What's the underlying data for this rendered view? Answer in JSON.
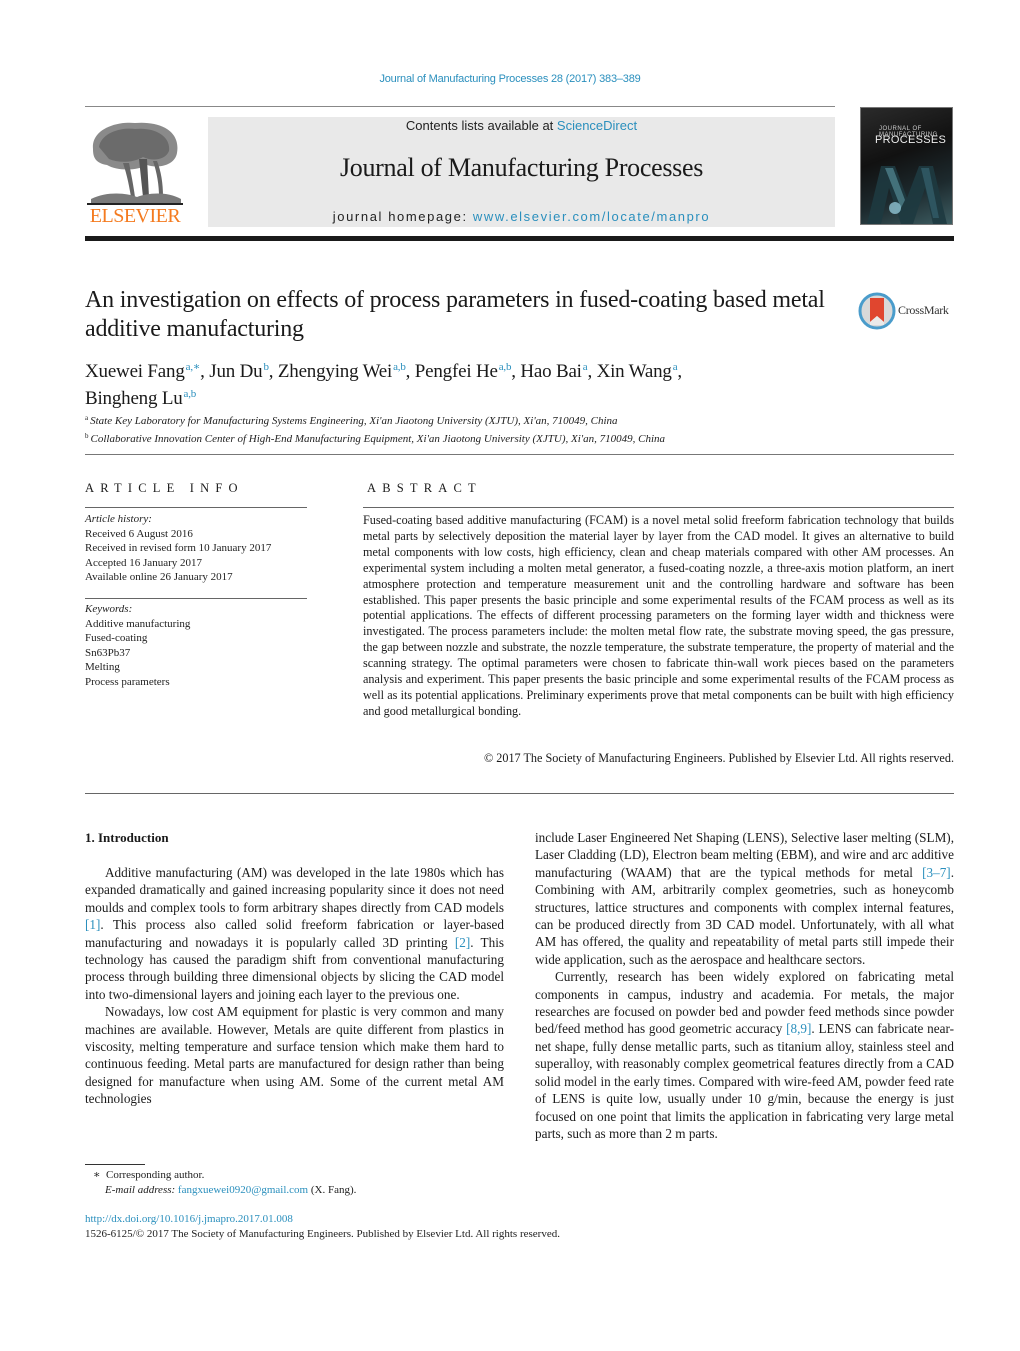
{
  "header": {
    "citation": "Journal of Manufacturing Processes 28 (2017) 383–389",
    "contents_prefix": "Contents lists available at ",
    "contents_link": "ScienceDirect",
    "journal_name": "Journal of Manufacturing Processes",
    "homepage_prefix": "journal homepage: ",
    "homepage_link": "www.elsevier.com/locate/manpro",
    "publisher_logo_text": "ELSEVIER",
    "cover_small_title": "JOURNAL OF MANUFACTURING",
    "cover_big_title": "PROCESSES",
    "colors": {
      "link": "#2a8fbd",
      "elsevier_orange": "#f47b20",
      "masthead_bg": "#e9e9e9"
    }
  },
  "article": {
    "title": "An investigation on effects of process parameters in fused-coating based metal additive manufacturing",
    "crossmark_label": "CrossMark",
    "authors": [
      {
        "name": "Xuewei Fang",
        "sup": "a,∗",
        "sep": ", "
      },
      {
        "name": "Jun Du",
        "sup": "b",
        "sep": ", "
      },
      {
        "name": "Zhengying Wei",
        "sup": "a,b",
        "sep": ", "
      },
      {
        "name": "Pengfei He",
        "sup": "a,b",
        "sep": ", "
      },
      {
        "name": "Hao Bai",
        "sup": "a",
        "sep": ", "
      },
      {
        "name": "Xin Wang",
        "sup": "a",
        "sep": ","
      },
      {
        "name": "Bingheng Lu",
        "sup": "a,b",
        "sep": ""
      }
    ],
    "affiliations": [
      {
        "mark": "a",
        "text": "State Key Laboratory for Manufacturing Systems Engineering, Xi'an Jiaotong University (XJTU), Xi'an, 710049, China"
      },
      {
        "mark": "b",
        "text": "Collaborative Innovation Center of High-End Manufacturing Equipment, Xi'an Jiaotong University (XJTU), Xi'an, 710049, China"
      }
    ]
  },
  "article_info": {
    "heading": "ARTICLE INFO",
    "history_label": "Article history:",
    "history": [
      "Received 6 August 2016",
      "Received in revised form 10 January 2017",
      "Accepted 16 January 2017",
      "Available online 26 January 2017"
    ],
    "keywords_label": "Keywords:",
    "keywords": [
      "Additive manufacturing",
      "Fused-coating",
      "Sn63Pb37",
      "Melting",
      "Process parameters"
    ]
  },
  "abstract": {
    "heading": "ABSTRACT",
    "text": "Fused-coating based additive manufacturing (FCAM) is a novel metal solid freeform fabrication technol­ogy that builds metal parts by selectively deposition the material layer by layer from the CAD model. It gives an alternative to build metal components with low costs, high efficiency, clean and cheap mate­rials compared with other AM processes. An experimental system including a molten metal generator, a fused-coating nozzle, a three-axis motion platform, an inert atmosphere protection and temperature measurement unit and the controlling hardware and software has been established. This paper presents the basic principle and some experimental results of the FCAM process as well as its potential appli­cations. The effects of different processing parameters on the forming layer width and thickness were investigated. The process parameters include: the molten metal flow rate, the substrate moving speed, the gas pressure, the gap between nozzle and substrate, the nozzle temperature, the substrate tempera­ture, the property of material and the scanning strategy. The optimal parameters were chosen to fabricate thin-wall work pieces based on the parameters analysis and experiment. This paper presents the basic principle and some experimental results of the FCAM process as well as its potential applications. Prelim­inary experiments prove that metal components can be built with high efficiency and good metallurgical bonding.",
    "copyright": "© 2017 The Society of Manufacturing Engineers. Published by Elsevier Ltd. All rights reserved."
  },
  "body": {
    "section_heading": "1.  Introduction",
    "left_col": {
      "p1_a": "Additive manufacturing (AM) was developed in the late 1980s which has expanded dramatically and gained increasing popularity since it does not need moulds and complex tools to form arbitrary shapes directly from CAD models ",
      "p1_ref1": "[1]",
      "p1_b": ". This process also called solid freeform fabrication or layer-based manufacturing and nowadays it is popularly called 3D printing ",
      "p1_ref2": "[2]",
      "p1_c": ". This technology has caused the paradigm shift from conventional manufacturing process through building three dimensional objects by slicing the CAD model into two-dimensional layers and joining each layer to the previous one.",
      "p2": "Nowadays, low cost AM equipment for plastic is very common and many machines are available. However, Metals are quite dif­ferent from plastics in viscosity, melting temperature and surface tension which make them hard to continuous feeding. Metal parts are manufactured for design rather than being designed for manu­facture when using AM. Some of the current metal AM technologies"
    },
    "right_col": {
      "p1_a": "include Laser Engineered Net Shaping (LENS), Selective laser melt­ing (SLM), Laser Cladding (LD), Electron beam melting (EBM), and wire and arc additive manufacturing (WAAM) that are the typical methods for metal ",
      "p1_ref": "[3–7]",
      "p1_b": ". Combining with AM, arbitrarily com­plex geometries, such as honeycomb structures, lattice structures and components with complex internal features, can be produced directly from 3D CAD model. Unfortunately, with all what AM has offered, the quality and repeatability of metal parts still impede their wide application, such as the aerospace and healthcare sec­tors.",
      "p2_a": "Currently, research has been widely explored on fabricating metal components in campus, industry and academia. For metals, the major researches are focused on powder bed and powder feed methods since powder bed/feed method has good geometric accu­racy ",
      "p2_ref": "[8,9]",
      "p2_b": ". LENS can fabricate near-net shape, fully dense metallic parts, such as titanium alloy, stainless steel and superalloy, with reasonably complex geometrical features directly from a CAD solid model in the early times. Compared with wire-feed AM, powder feed rate of LENS is quite low, usually under 10 g/min, because the energy is just focused on one point that limits the application in fabricating very large metal parts, such as more than 2 m parts."
    }
  },
  "footnotes": {
    "star": "∗",
    "corresponding": "Corresponding author.",
    "email_label": "E-mail address: ",
    "email": "fangxuewei0920@gmail.com",
    "email_suffix": " (X. Fang).",
    "doi": "http://dx.doi.org/10.1016/j.jmapro.2017.01.008",
    "issn_copyright": "1526-6125/© 2017 The Society of Manufacturing Engineers. Published by Elsevier Ltd. All rights reserved."
  }
}
